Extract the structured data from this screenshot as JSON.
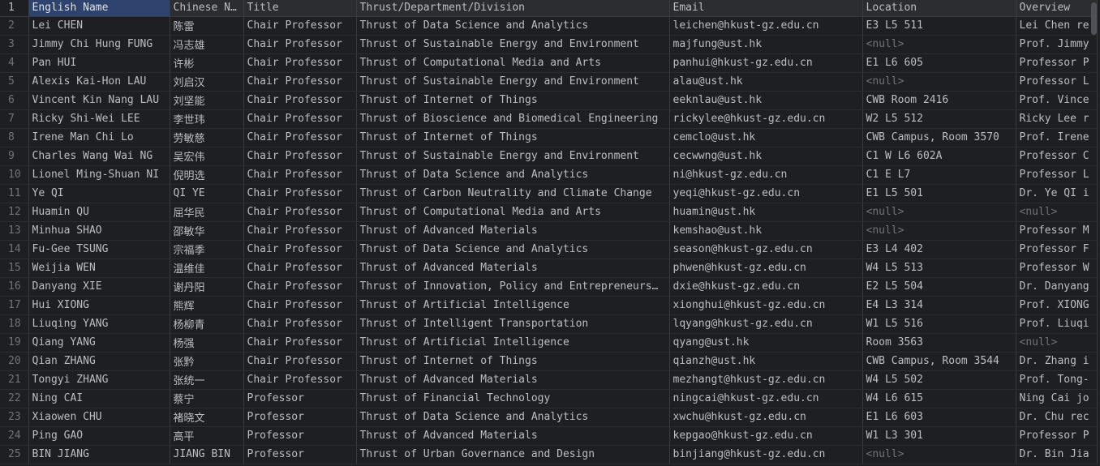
{
  "columns": [
    "1",
    "English Name",
    "Chinese N…",
    "Title",
    "Thrust/Department/Division",
    "Email",
    "Location",
    "Overview"
  ],
  "null_text": "<null>",
  "rows": [
    {
      "n": "2",
      "en": "Lei CHEN",
      "cn": "陈雷",
      "title": "Chair Professor",
      "thrust": "Thrust of Data Science and Analytics",
      "email": "leichen@hkust-gz.edu.cn",
      "loc": "E3 L5 511",
      "ov": "Lei Chen re"
    },
    {
      "n": "3",
      "en": "Jimmy Chi Hung FUNG",
      "cn": "冯志雄",
      "title": "Chair Professor",
      "thrust": "Thrust of Sustainable Energy and Environment",
      "email": "majfung@ust.hk",
      "loc": "<null>",
      "ov": "Prof. Jimmy"
    },
    {
      "n": "4",
      "en": "Pan HUI",
      "cn": "许彬",
      "title": "Chair Professor",
      "thrust": "Thrust of Computational Media and Arts",
      "email": "panhui@hkust-gz.edu.cn",
      "loc": "E1 L6 605",
      "ov": "Professor P"
    },
    {
      "n": "5",
      "en": "Alexis Kai-Hon LAU",
      "cn": "刘启汉",
      "title": "Chair Professor",
      "thrust": "Thrust of Sustainable Energy and Environment",
      "email": "alau@ust.hk",
      "loc": "<null>",
      "ov": "Professor L"
    },
    {
      "n": "6",
      "en": "Vincent Kin Nang LAU",
      "cn": "刘坚能",
      "title": "Chair Professor",
      "thrust": "Thrust of Internet of Things",
      "email": "eeknlau@ust.hk",
      "loc": "CWB Room 2416",
      "ov": "Prof. Vince"
    },
    {
      "n": "7",
      "en": "Ricky Shi-Wei LEE",
      "cn": "李世玮",
      "title": "Chair Professor",
      "thrust": "Thrust of Bioscience and Biomedical Engineering",
      "email": "rickylee@hkust-gz.edu.cn",
      "loc": "W2 L5 512",
      "ov": "Ricky Lee r"
    },
    {
      "n": "8",
      "en": "Irene Man Chi Lo",
      "cn": "劳敏慈",
      "title": "Chair Professor",
      "thrust": "Thrust of Internet of Things",
      "email": "cemclo@ust.hk",
      "loc": "CWB Campus, Room 3570",
      "ov": "Prof. Irene"
    },
    {
      "n": "9",
      "en": "Charles Wang Wai NG",
      "cn": "吴宏伟",
      "title": "Chair Professor",
      "thrust": "Thrust of Sustainable Energy and Environment",
      "email": "cecwwng@ust.hk",
      "loc": "C1 W L6 602A",
      "ov": "Professor C"
    },
    {
      "n": "10",
      "en": "Lionel Ming-Shuan NI",
      "cn": "倪明选",
      "title": "Chair Professor",
      "thrust": "Thrust of Data Science and Analytics",
      "email": "ni@hkust-gz.edu.cn",
      "loc": "C1 E L7",
      "ov": "Professor L"
    },
    {
      "n": "11",
      "en": "Ye QI",
      "cn": "QI YE",
      "title": "Chair Professor",
      "thrust": "Thrust of Carbon Neutrality and Climate Change",
      "email": "yeqi@hkust-gz.edu.cn",
      "loc": "E1 L5 501",
      "ov": "Dr. Ye QI i"
    },
    {
      "n": "12",
      "en": "Huamin QU",
      "cn": "屈华民",
      "title": "Chair Professor",
      "thrust": "Thrust of Computational Media and Arts",
      "email": "huamin@ust.hk",
      "loc": "<null>",
      "ov": "<null>"
    },
    {
      "n": "13",
      "en": "Minhua SHAO",
      "cn": "邵敏华",
      "title": "Chair Professor",
      "thrust": "Thrust of Advanced Materials",
      "email": "kemshao@ust.hk",
      "loc": "<null>",
      "ov": "Professor M"
    },
    {
      "n": "14",
      "en": "Fu-Gee TSUNG",
      "cn": "宗福季",
      "title": "Chair Professor",
      "thrust": "Thrust of Data Science and Analytics",
      "email": "season@hkust-gz.edu.cn",
      "loc": "E3 L4 402",
      "ov": "Professor F"
    },
    {
      "n": "15",
      "en": "Weijia WEN",
      "cn": "温维佳",
      "title": "Chair Professor",
      "thrust": "Thrust of Advanced Materials",
      "email": "phwen@hkust-gz.edu.cn",
      "loc": "W4 L5 513",
      "ov": "Professor W"
    },
    {
      "n": "16",
      "en": "Danyang XIE",
      "cn": "谢丹阳",
      "title": "Chair Professor",
      "thrust": "Thrust of Innovation, Policy and Entrepreneurs…",
      "email": "dxie@hkust-gz.edu.cn",
      "loc": "E2 L5 504",
      "ov": "Dr. Danyang"
    },
    {
      "n": "17",
      "en": "Hui XIONG",
      "cn": "熊辉",
      "title": "Chair Professor",
      "thrust": "Thrust of Artificial Intelligence",
      "email": "xionghui@hkust-gz.edu.cn",
      "loc": "E4 L3 314",
      "ov": "Prof. XIONG"
    },
    {
      "n": "18",
      "en": "Liuqing YANG",
      "cn": "杨柳青",
      "title": "Chair Professor",
      "thrust": "Thrust of Intelligent Transportation",
      "email": "lqyang@hkust-gz.edu.cn",
      "loc": "W1 L5 516",
      "ov": "Prof. Liuqi"
    },
    {
      "n": "19",
      "en": "Qiang YANG",
      "cn": "杨强",
      "title": "Chair Professor",
      "thrust": "Thrust of Artificial Intelligence",
      "email": "qyang@ust.hk",
      "loc": "Room 3563",
      "ov": "<null>"
    },
    {
      "n": "20",
      "en": "Qian ZHANG",
      "cn": "张黔",
      "title": "Chair Professor",
      "thrust": "Thrust of Internet of Things",
      "email": "qianzh@ust.hk",
      "loc": "CWB Campus, Room 3544",
      "ov": "Dr. Zhang i"
    },
    {
      "n": "21",
      "en": "Tongyi ZHANG",
      "cn": "张统一",
      "title": "Chair Professor",
      "thrust": "Thrust of Advanced Materials",
      "email": "mezhangt@hkust-gz.edu.cn",
      "loc": "W4 L5 502",
      "ov": "Prof. Tong-"
    },
    {
      "n": "22",
      "en": "Ning CAI",
      "cn": "蔡宁",
      "title": "Professor",
      "thrust": "Thrust of Financial Technology",
      "email": "ningcai@hkust-gz.edu.cn",
      "loc": "W4 L6 615",
      "ov": "Ning Cai jo"
    },
    {
      "n": "23",
      "en": "Xiaowen CHU",
      "cn": "褚晓文",
      "title": "Professor",
      "thrust": "Thrust of Data Science and Analytics",
      "email": "xwchu@hkust-gz.edu.cn",
      "loc": "E1 L6 603",
      "ov": "Dr. Chu rec"
    },
    {
      "n": "24",
      "en": "Ping GAO",
      "cn": "高平",
      "title": "Professor",
      "thrust": "Thrust of Advanced Materials",
      "email": "kepgao@hkust-gz.edu.cn",
      "loc": "W1 L3 301",
      "ov": "Professor P"
    },
    {
      "n": "25",
      "en": "BIN JIANG",
      "cn": "JIANG BIN",
      "title": "Professor",
      "thrust": "Thrust of Urban Governance and Design",
      "email": "binjiang@hkust-gz.edu.cn",
      "loc": "<null>",
      "ov": "Dr. Bin Jia"
    }
  ]
}
